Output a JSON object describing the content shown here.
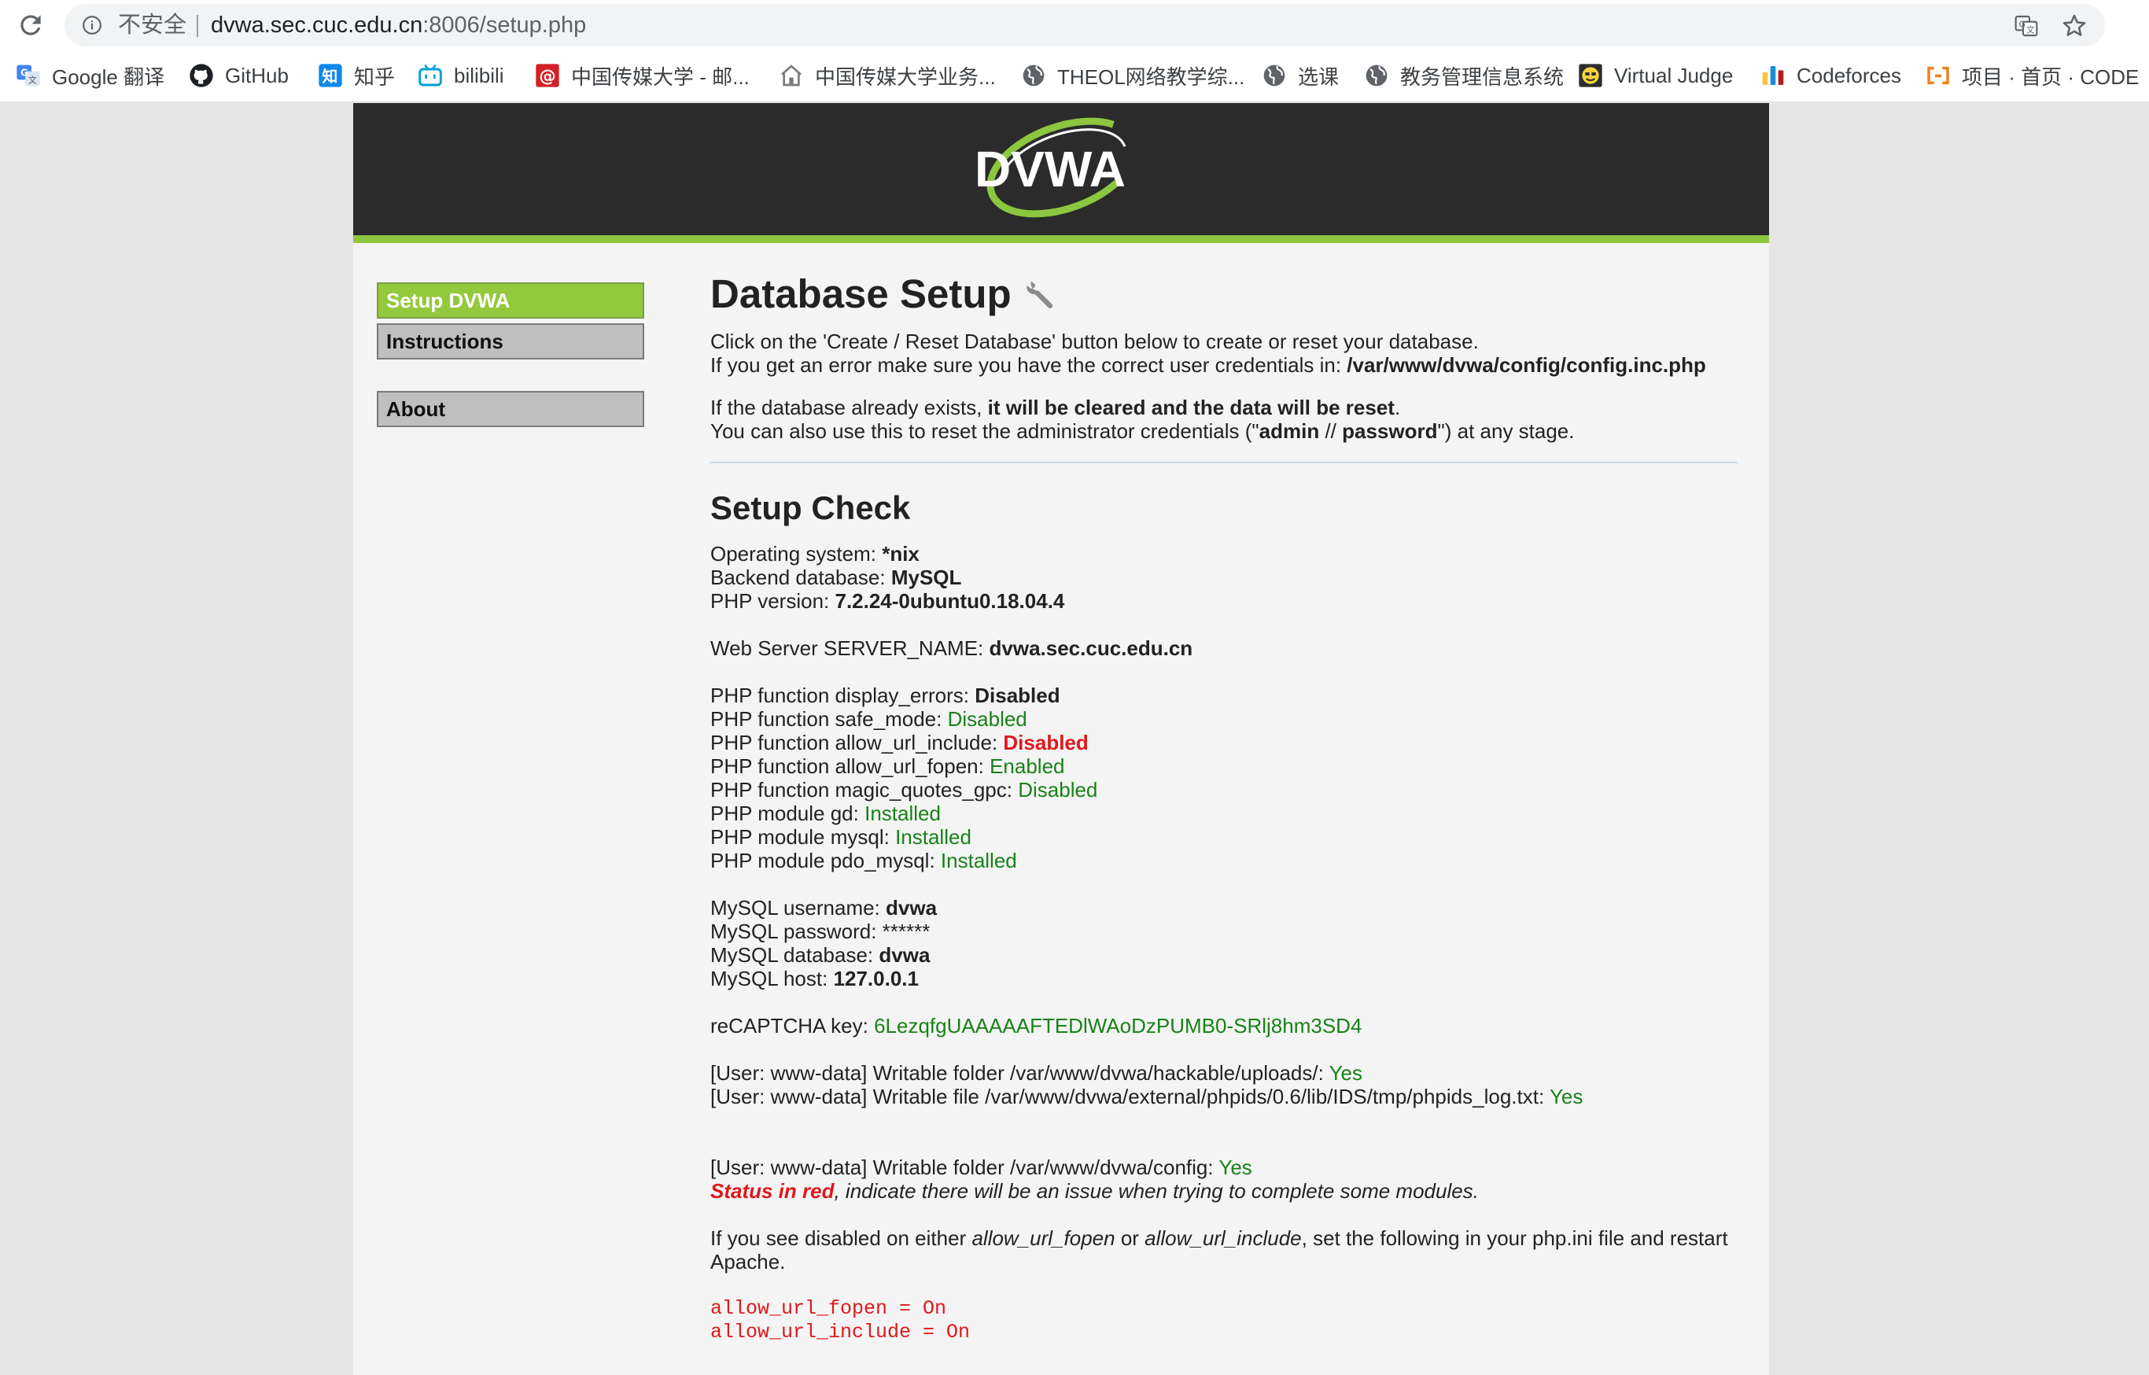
{
  "browser": {
    "security_label": "不安全",
    "url_host": "dvwa.sec.cuc.edu.cn",
    "url_rest": ":8006/setup.php",
    "bookmarks": [
      {
        "label": "Google 翻译",
        "icon": "google-translate-icon"
      },
      {
        "label": "GitHub",
        "icon": "github-icon"
      },
      {
        "label": "知乎",
        "icon": "zhihu-icon"
      },
      {
        "label": "bilibili",
        "icon": "bilibili-icon"
      },
      {
        "label": "中国传媒大学 - 邮...",
        "icon": "mail-icon"
      },
      {
        "label": "中国传媒大学业务...",
        "icon": "house-icon"
      },
      {
        "label": "THEOL网络教学综...",
        "icon": "globe-icon"
      },
      {
        "label": "选课",
        "icon": "globe-icon"
      },
      {
        "label": "教务管理信息系统",
        "icon": "globe-icon"
      },
      {
        "label": "Virtual Judge",
        "icon": "virtual-judge-icon"
      },
      {
        "label": "Codeforces",
        "icon": "codeforces-icon"
      },
      {
        "label": "项目 · 首页 · CODE",
        "icon": "code-icon"
      }
    ]
  },
  "header": {
    "logo_text": "DVWA",
    "stripe_color": "#8dc63f"
  },
  "menu": {
    "setup": "Setup DVWA",
    "instructions": "Instructions",
    "about": "About"
  },
  "intro": {
    "title": "Database Setup",
    "line1": "Click on the 'Create / Reset Database' button below to create or reset your database.",
    "line2_prefix": "If you get an error make sure you have the correct user credentials in: ",
    "line2_path": "/var/www/dvwa/config/config.inc.php",
    "line3_prefix": "If the database already exists, ",
    "line3_bold": "it will be cleared and the data will be reset",
    "line3_suffix": ".",
    "line4_prefix": "You can also use this to reset the administrator credentials (\"",
    "line4_admin": "admin",
    "line4_sep": " // ",
    "line4_password": "password",
    "line4_suffix": "\") at any stage."
  },
  "setup_check": {
    "title": "Setup Check",
    "os_label": "Operating system: ",
    "os_value": "*nix",
    "db_label": "Backend database: ",
    "db_value": "MySQL",
    "php_label": "PHP version: ",
    "php_value": "7.2.24-0ubuntu0.18.04.4",
    "server_label": "Web Server SERVER_NAME: ",
    "server_value": "dvwa.sec.cuc.edu.cn",
    "functions": [
      {
        "label": "PHP function display_errors: ",
        "value": "Disabled",
        "style": "bold"
      },
      {
        "label": "PHP function safe_mode: ",
        "value": "Disabled",
        "style": "green"
      },
      {
        "label": "PHP function allow_url_include: ",
        "value": "Disabled",
        "style": "red"
      },
      {
        "label": "PHP function allow_url_fopen: ",
        "value": "Enabled",
        "style": "green"
      },
      {
        "label": "PHP function magic_quotes_gpc: ",
        "value": "Disabled",
        "style": "green"
      },
      {
        "label": "PHP module gd: ",
        "value": "Installed",
        "style": "green"
      },
      {
        "label": "PHP module mysql: ",
        "value": "Installed",
        "style": "green"
      },
      {
        "label": "PHP module pdo_mysql: ",
        "value": "Installed",
        "style": "green"
      }
    ],
    "mysql_user_label": "MySQL username: ",
    "mysql_user": "dvwa",
    "mysql_pass_label": "MySQL password: ",
    "mysql_pass": "******",
    "mysql_db_label": "MySQL database: ",
    "mysql_db": "dvwa",
    "mysql_host_label": "MySQL host: ",
    "mysql_host": "127.0.0.1",
    "recaptcha_label": "reCAPTCHA key: ",
    "recaptcha_value": "6LezqfgUAAAAAFTEDlWAoDzPUMB0-SRlj8hm3SD4",
    "writable_uploads_label": "[User: www-data] Writable folder /var/www/dvwa/hackable/uploads/: ",
    "writable_uploads_value": "Yes",
    "writable_phpids_label": "[User: www-data] Writable file /var/www/dvwa/external/phpids/0.6/lib/IDS/tmp/phpids_log.txt: ",
    "writable_phpids_value": "Yes",
    "writable_config_label": "[User: www-data] Writable folder /var/www/dvwa/config: ",
    "writable_config_value": "Yes",
    "status_red": "Status in red",
    "status_rest": ", indicate there will be an issue when trying to complete some modules.",
    "hint_prefix": "If you see disabled on either ",
    "hint_fopen": "allow_url_fopen",
    "hint_or": " or ",
    "hint_include": "allow_url_include",
    "hint_suffix": ", set the following in your php.ini file and restart Apache.",
    "code_line1": "allow_url_fopen = On",
    "code_line2": "allow_url_include = On"
  }
}
